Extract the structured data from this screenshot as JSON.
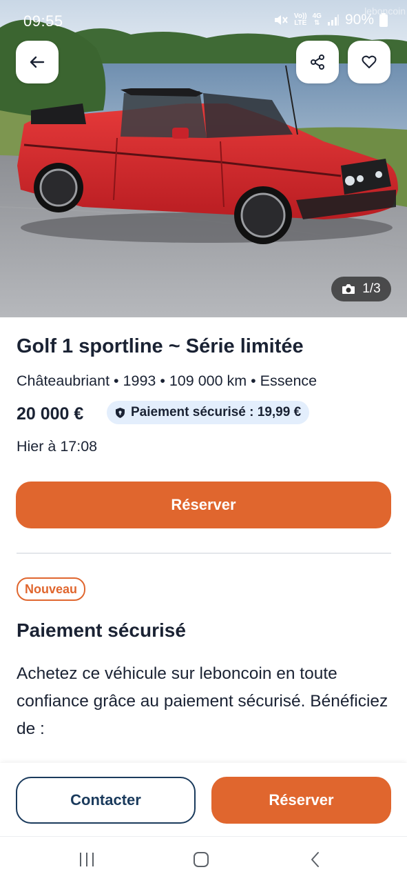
{
  "status_bar": {
    "time": "09:55",
    "network_top": "Vo))",
    "network_bottom": "LTE",
    "gen_top": "4G",
    "gen_bottom": "⇅",
    "battery": "90%",
    "watermark": "leboncoin"
  },
  "hero": {
    "photo_counter": "1/3",
    "icons": {
      "back": "arrow-left-icon",
      "share": "share-icon",
      "favorite": "heart-icon",
      "camera": "camera-icon"
    }
  },
  "listing": {
    "title": "Golf 1 sportline ~ Série limitée",
    "meta": "Châteaubriant • 1993 • 109 000 km • Essence",
    "price": "20 000 €",
    "secure_payment_badge": "Paiement sécurisé : 19,99 €",
    "date": "Hier à 17:08",
    "reserve_label": "Réserver"
  },
  "secure_section": {
    "badge": "Nouveau",
    "title": "Paiement sécurisé",
    "text": "Achetez ce véhicule sur leboncoin en toute confiance grâce au paiement sécurisé. Bénéficiez de :"
  },
  "action_bar": {
    "contact_label": "Contacter",
    "reserve_label": "Réserver"
  },
  "colors": {
    "accent": "#e0662e",
    "navy": "#1a3a5c",
    "text": "#1a2233",
    "badge_bg": "#e3eefc"
  }
}
